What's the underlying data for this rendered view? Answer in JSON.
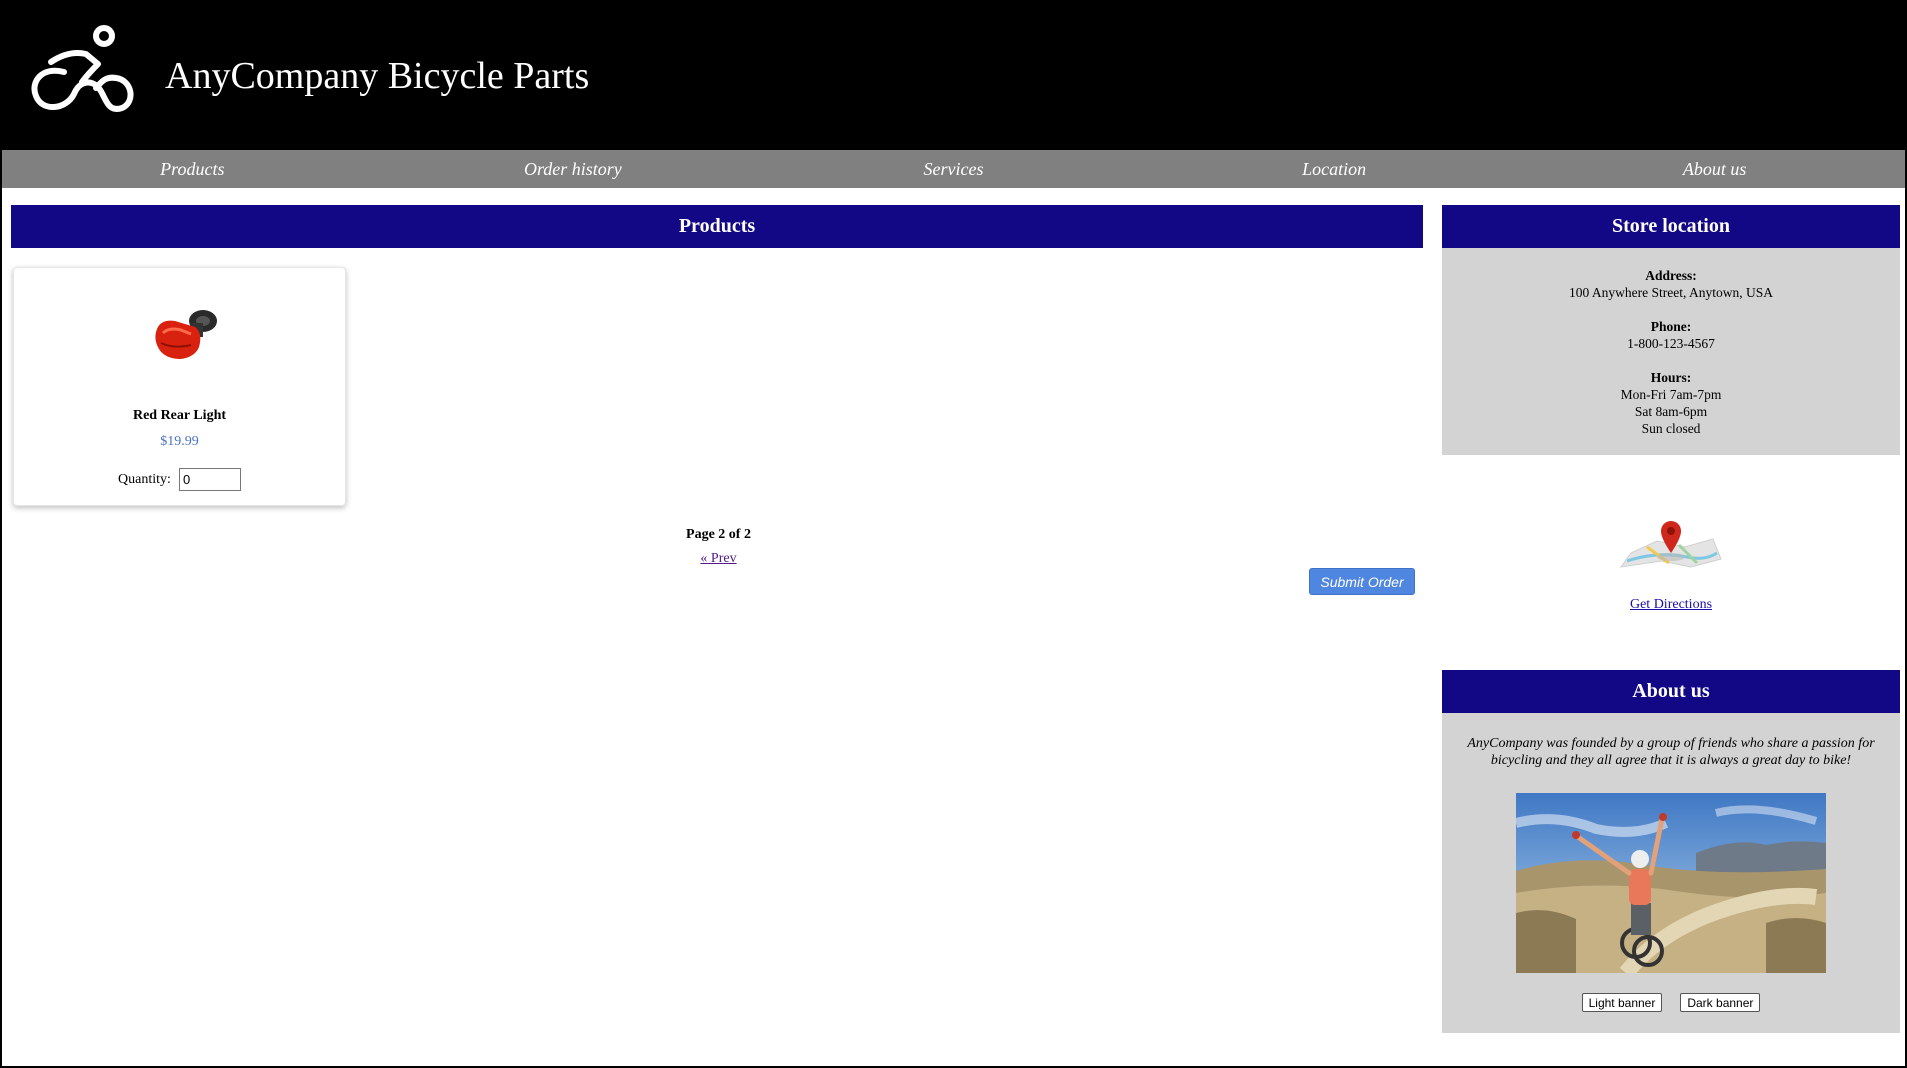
{
  "header": {
    "title": "AnyCompany Bicycle Parts",
    "logo_icon": "cyclist-icon"
  },
  "nav": [
    {
      "label": "Products"
    },
    {
      "label": "Order history"
    },
    {
      "label": "Services"
    },
    {
      "label": "Location"
    },
    {
      "label": "About us"
    }
  ],
  "products": {
    "heading": "Products",
    "items": [
      {
        "name": "Red Rear Light",
        "price": "$19.99",
        "quantity_label": "Quantity:",
        "quantity_value": "0",
        "image_icon": "rear-light-icon"
      }
    ],
    "page_info": "Page 2 of 2",
    "prev_label": "« Prev",
    "submit_label": "Submit Order"
  },
  "store": {
    "heading": "Store location",
    "address_label": "Address:",
    "address": "100 Anywhere Street, Anytown, USA",
    "phone_label": "Phone:",
    "phone": "1-800-123-4567",
    "hours_label": "Hours:",
    "hours": [
      "Mon-Fri 7am-7pm",
      "Sat 8am-6pm",
      "Sun closed"
    ],
    "map_icon": "map-pin-icon",
    "directions_label": "Get Directions"
  },
  "about": {
    "heading": "About us",
    "text": "AnyCompany was founded by a group of friends who share a passion for bicycling and they all agree that it is always a great day to bike!",
    "photo_icon": "cyclist-photo",
    "light_banner_label": "Light banner",
    "dark_banner_label": "Dark banner"
  },
  "colors": {
    "header_bg": "#000000",
    "nav_bg": "#808080",
    "section_header_bg": "#120886",
    "panel_bg": "#d3d3d3",
    "price": "#4a72c4",
    "submit_bg": "#4f86e0"
  }
}
